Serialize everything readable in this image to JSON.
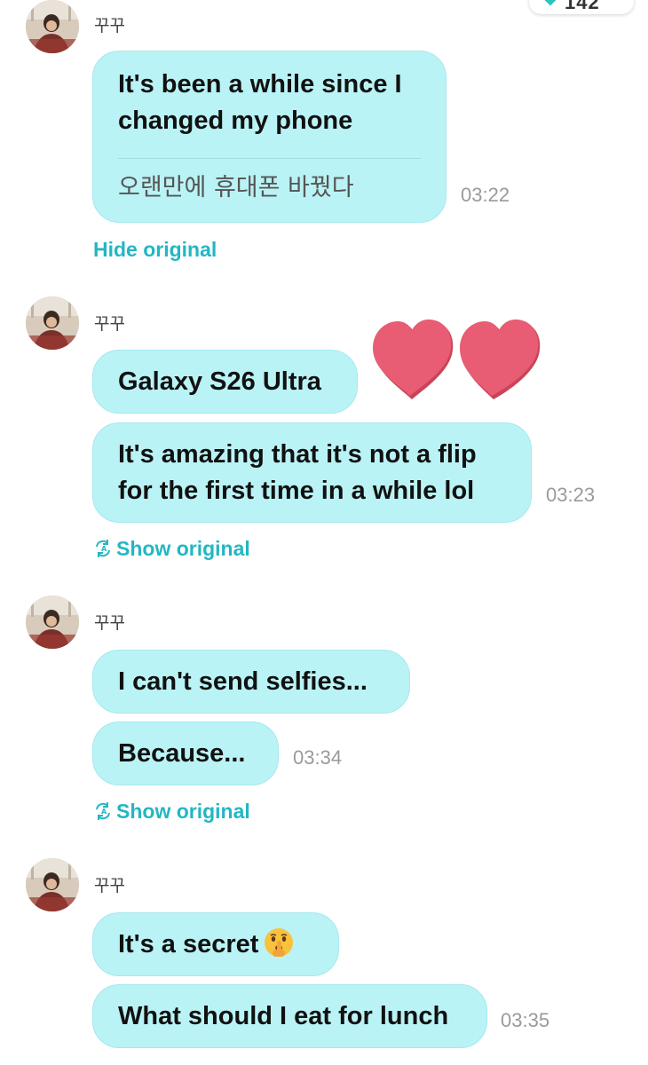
{
  "status_pill": {
    "text": "142"
  },
  "colors": {
    "bubble_bg": "#baf3f5",
    "bubble_border": "#a6e8ee",
    "link": "#22b7c3",
    "time": "#9a9a9a",
    "heart": "#e85d73"
  },
  "messages": [
    {
      "sender": "꾸꾸",
      "bubbles": [
        {
          "lines": [
            "It's been a while since I",
            "changed my phone"
          ],
          "original": "오랜만에 휴대폰 바꿨다"
        }
      ],
      "time": "03:22",
      "toggle": "Hide original",
      "toggle_icon": "none"
    },
    {
      "sender": "꾸꾸",
      "bubbles": [
        {
          "lines": [
            "Galaxy S26 Ultra"
          ]
        },
        {
          "lines": [
            "It's amazing that it's not a flip",
            "for the first time in a while lol"
          ]
        }
      ],
      "sticker": "two-hearts-icon",
      "time": "03:23",
      "toggle": "Show original",
      "toggle_icon": "translate-icon"
    },
    {
      "sender": "꾸꾸",
      "bubbles": [
        {
          "lines": [
            "I can't send selfies..."
          ]
        },
        {
          "lines": [
            "Because..."
          ]
        }
      ],
      "time": "03:34",
      "toggle": "Show original",
      "toggle_icon": "translate-icon"
    },
    {
      "sender": "꾸꾸",
      "bubbles": [
        {
          "lines": [
            "It's a secret"
          ],
          "emoji": "shushing-face-icon"
        },
        {
          "lines": [
            "What should I eat for lunch"
          ]
        }
      ],
      "time": "03:35"
    }
  ]
}
